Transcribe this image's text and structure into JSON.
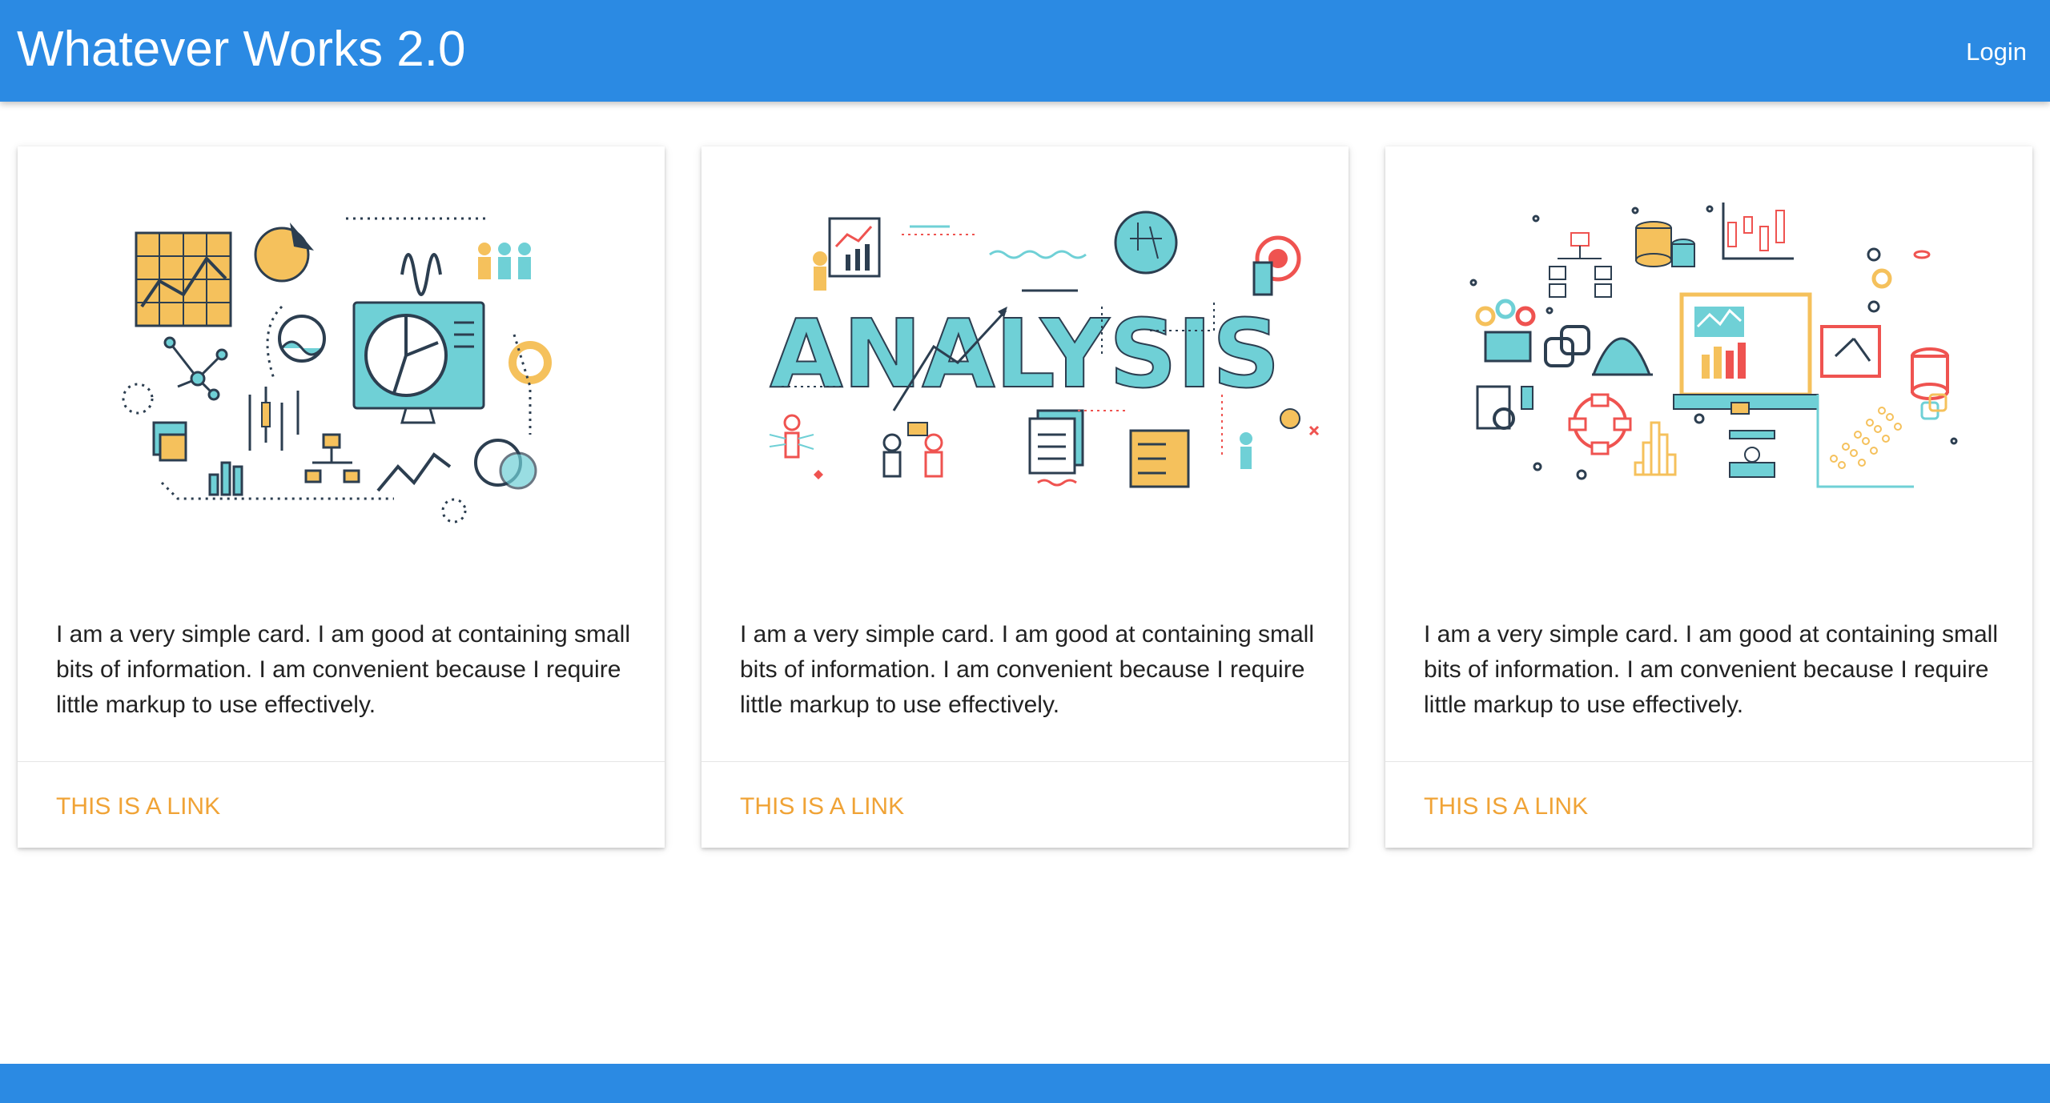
{
  "navbar": {
    "brand": "Whatever Works 2.0",
    "login": "Login",
    "color": "#2b8ae3"
  },
  "cards": [
    {
      "illustration": "data-analytics-icons-illustration",
      "text": "I am a very simple card. I am good at containing small bits of information. I am convenient because I require little markup to use effectively.",
      "link": "THIS IS A LINK"
    },
    {
      "illustration": "analysis-word-illustration",
      "image_word": "ANALYSIS",
      "text": "I am a very simple card. I am good at containing small bits of information. I am convenient because I require little markup to use effectively.",
      "link": "THIS IS A LINK"
    },
    {
      "illustration": "data-science-icons-illustration",
      "text": "I am a very simple card. I am good at containing small bits of information. I am convenient because I require little markup to use effectively.",
      "link": "THIS IS A LINK"
    }
  ],
  "colors": {
    "accent_link": "#f0a336",
    "illustration_teal": "#6fd0d6",
    "illustration_yellow": "#f5c15c",
    "illustration_red": "#ef5350",
    "illustration_navy": "#2c3e50"
  }
}
